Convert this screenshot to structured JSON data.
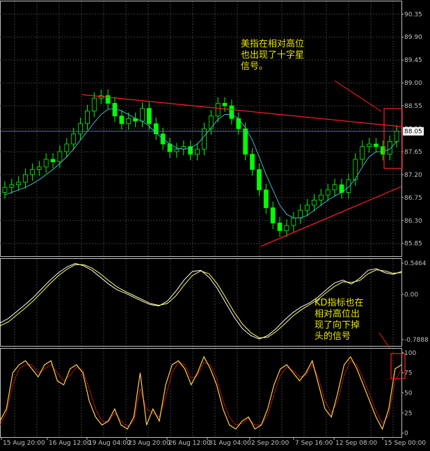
{
  "colors": {
    "background": "#000000",
    "grid": "#3c3c3c",
    "axis": "#c0c0c0",
    "bull_candle": "#00ff00",
    "bear_candle": "#00ff00",
    "ma_line": "#3fb6c8",
    "trend_line": "#ff2020",
    "highlight_box": "#ff2020",
    "osc_white": "#ffffff",
    "osc_yellow": "#ffff66",
    "k_line": "#ffd24a",
    "d_line": "#ff2020",
    "annotation_text": "#e6e600",
    "price_label_bg": "#ffffff",
    "price_label_text": "#000000"
  },
  "annotations": {
    "price": "美指在相对高位\n也出现了十字星\n信号。",
    "kd": "KD指标也在\n相对高位出\n现了向下掉\n头的信号"
  },
  "chart_data": [
    {
      "type": "candlestick",
      "panel": "price",
      "yticks": [
        "90.35",
        "89.90",
        "89.45",
        "89.00",
        "88.55",
        "88.10",
        "87.65",
        "87.20",
        "86.75",
        "86.30",
        "85.85"
      ],
      "ylim": [
        85.85,
        90.35
      ],
      "current_price_label": "88.05",
      "close": [
        86.95,
        87.0,
        87.05,
        87.2,
        87.3,
        87.35,
        87.5,
        87.45,
        87.65,
        87.8,
        88.0,
        88.2,
        88.45,
        88.7,
        88.75,
        88.6,
        88.35,
        88.2,
        88.3,
        88.25,
        88.5,
        88.2,
        88.0,
        87.8,
        87.65,
        87.7,
        87.75,
        87.6,
        87.7,
        88.1,
        88.35,
        88.6,
        88.55,
        88.3,
        88.1,
        87.6,
        87.3,
        86.9,
        86.55,
        86.25,
        86.1,
        86.2,
        86.35,
        86.5,
        86.6,
        86.7,
        86.8,
        86.9,
        87.0,
        86.85,
        87.1,
        87.5,
        87.75,
        87.8,
        87.75,
        87.6,
        87.85,
        88.05
      ],
      "moving_average": [
        86.8,
        86.85,
        86.9,
        86.95,
        87.02,
        87.1,
        87.2,
        87.3,
        87.42,
        87.55,
        87.7,
        87.88,
        88.05,
        88.22,
        88.38,
        88.48,
        88.5,
        88.45,
        88.38,
        88.3,
        88.25,
        88.15,
        88.02,
        87.9,
        87.8,
        87.72,
        87.7,
        87.72,
        87.8,
        87.95,
        88.12,
        88.28,
        88.38,
        88.38,
        88.3,
        88.12,
        87.88,
        87.55,
        87.2,
        86.9,
        86.6,
        86.42,
        86.35,
        86.35,
        86.4,
        86.5,
        86.6,
        86.7,
        86.78,
        86.85,
        86.95,
        87.12,
        87.35,
        87.55,
        87.65,
        87.65,
        87.7,
        87.85
      ]
    },
    {
      "type": "line",
      "panel": "oscillator",
      "yticks": [
        "0.5464",
        "0.00",
        "-0.7888"
      ],
      "ylim": [
        -0.7888,
        0.5464
      ],
      "series": [
        {
          "values": [
            -0.5,
            -0.42,
            -0.3,
            -0.18,
            -0.05,
            0.1,
            0.25,
            0.38,
            0.48,
            0.54,
            0.5,
            0.42,
            0.3,
            0.18,
            0.08,
            0.02,
            -0.05,
            -0.12,
            -0.18,
            -0.2,
            -0.12,
            0.05,
            0.25,
            0.4,
            0.42,
            0.3,
            0.1,
            -0.15,
            -0.4,
            -0.6,
            -0.72,
            -0.78,
            -0.72,
            -0.6,
            -0.45,
            -0.32,
            -0.22,
            -0.15,
            -0.05,
            0.08,
            0.2,
            0.25,
            0.18,
            0.28,
            0.42,
            0.45,
            0.38,
            0.35,
            0.4
          ]
        },
        {
          "values": [
            -0.55,
            -0.48,
            -0.36,
            -0.24,
            -0.11,
            0.04,
            0.19,
            0.33,
            0.44,
            0.52,
            0.52,
            0.46,
            0.36,
            0.24,
            0.13,
            0.05,
            -0.02,
            -0.09,
            -0.16,
            -0.19,
            -0.16,
            -0.03,
            0.16,
            0.33,
            0.41,
            0.36,
            0.18,
            -0.06,
            -0.31,
            -0.52,
            -0.67,
            -0.76,
            -0.75,
            -0.65,
            -0.52,
            -0.38,
            -0.27,
            -0.18,
            -0.09,
            0.03,
            0.14,
            0.22,
            0.21,
            0.24,
            0.36,
            0.43,
            0.41,
            0.37,
            0.38
          ]
        }
      ]
    },
    {
      "type": "line",
      "panel": "stochastic",
      "yticks": [
        "100",
        "75",
        "50",
        "25",
        "0"
      ],
      "ylim": [
        0,
        100
      ],
      "x": [
        "15 Aug 20:00",
        "16 Aug 12:00",
        "19 Aug 04:00",
        "23 Aug 20:00",
        "26 Aug 12:00",
        "31 Aug 04:00",
        "2 Sep 20:00",
        "7 Sep 16:00",
        "12 Sep 08:00",
        "15 Sep 00:00"
      ],
      "series": [
        {
          "values": [
            15,
            30,
            75,
            85,
            90,
            80,
            70,
            85,
            90,
            65,
            60,
            80,
            85,
            75,
            40,
            20,
            10,
            15,
            30,
            10,
            5,
            20,
            75,
            10,
            30,
            15,
            60,
            85,
            90,
            80,
            60,
            75,
            95,
            80,
            60,
            30,
            10,
            5,
            15,
            20,
            5,
            10,
            30,
            60,
            80,
            85,
            75,
            65,
            75,
            90,
            60,
            30,
            20,
            50,
            85,
            95,
            80,
            60,
            40,
            20,
            5,
            30,
            80,
            85
          ]
        },
        {
          "values": [
            10,
            25,
            60,
            80,
            85,
            85,
            75,
            80,
            85,
            75,
            65,
            72,
            82,
            78,
            55,
            30,
            15,
            14,
            25,
            15,
            8,
            15,
            55,
            30,
            25,
            20,
            45,
            75,
            88,
            85,
            68,
            72,
            88,
            85,
            68,
            40,
            20,
            10,
            12,
            18,
            10,
            10,
            22,
            48,
            72,
            82,
            78,
            70,
            72,
            85,
            68,
            40,
            25,
            40,
            72,
            90,
            85,
            68,
            48,
            28,
            12,
            22,
            65,
            80
          ]
        }
      ]
    }
  ]
}
